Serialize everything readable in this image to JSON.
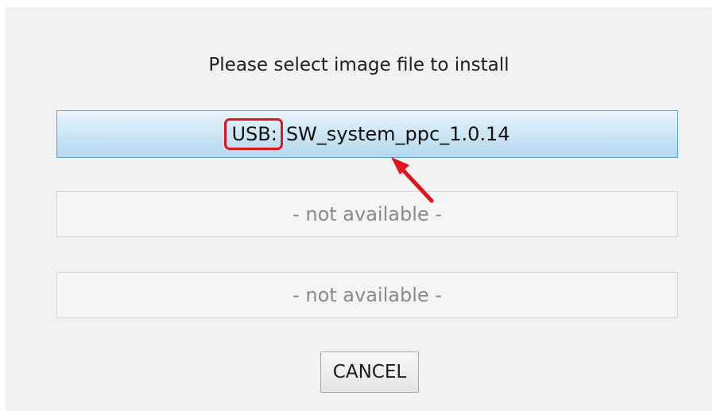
{
  "dialog": {
    "prompt": "Please select image file to install",
    "slots": [
      {
        "prefix": "USB:",
        "name": "SW_system_ppc_1.0.14",
        "state": "selected"
      },
      {
        "label": "- not available -",
        "state": "unavailable"
      },
      {
        "label": "- not available -",
        "state": "unavailable"
      }
    ],
    "cancel_label": "CANCEL"
  },
  "colors": {
    "highlight": "#e0141c",
    "selected_border": "#5aa5d6",
    "selected_fill": "#cfe7f6"
  }
}
